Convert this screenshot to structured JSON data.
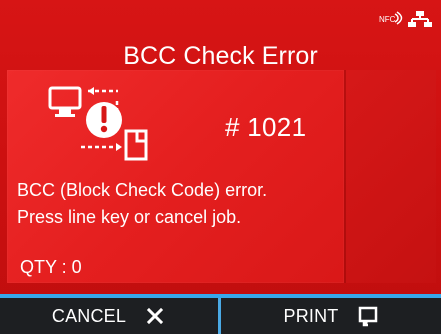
{
  "screen": {
    "title": "BCC Check Error",
    "error_code": "# 1021",
    "message_line_1": "BCC (Block Check Code) error.",
    "message_line_2": "Press line key or cancel job.",
    "qty": "QTY : 0"
  },
  "status_icons": [
    {
      "name": "nfc",
      "label": "NFC"
    },
    {
      "name": "network",
      "label": ""
    }
  ],
  "softkeys": {
    "cancel_label": "CANCEL",
    "print_label": "PRINT"
  },
  "colors": {
    "background": "#d41414",
    "panel": "#e41f1f",
    "softkey_bg": "#1d1f22",
    "softkey_accent": "#37a8ea",
    "text": "#ffffff"
  },
  "icons": {
    "nfc": "nfc-icon",
    "network": "network-icon",
    "error": "error-illustration-icon",
    "cancel": "close-icon",
    "print": "print-icon"
  }
}
